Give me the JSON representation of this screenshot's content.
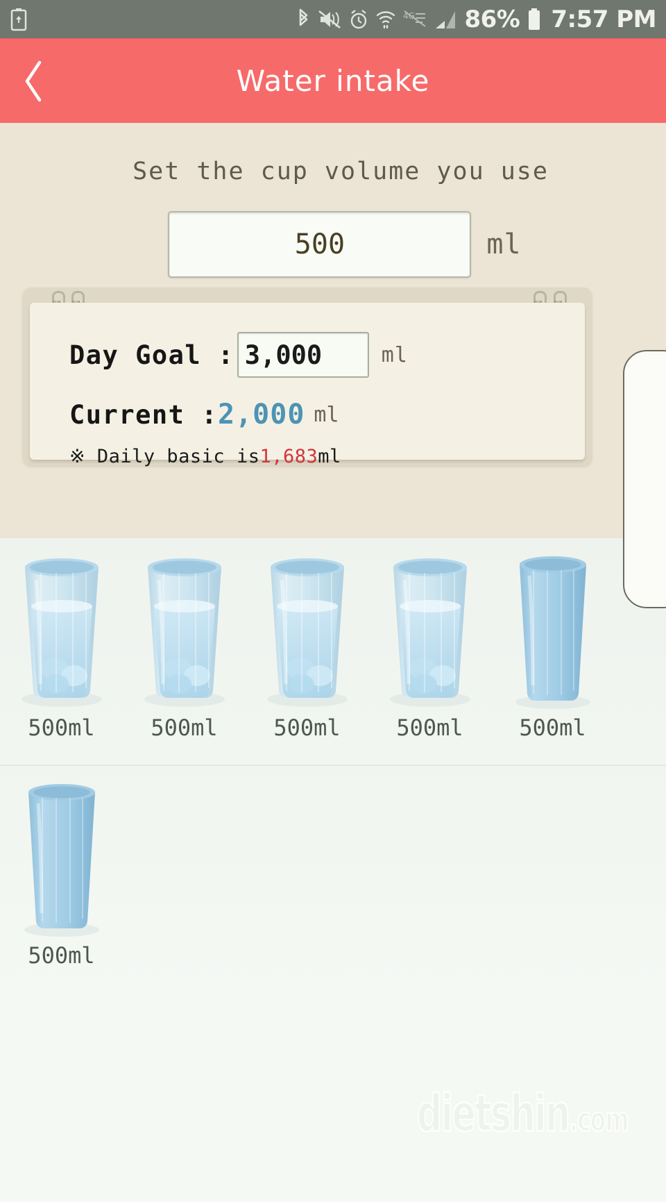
{
  "status_bar": {
    "left_icon": "battery-saver-icon",
    "icons": [
      "bluetooth-icon",
      "mute-vibrate-icon",
      "alarm-icon",
      "wifi-icon",
      "lte-data-icon",
      "signal-bars-icon"
    ],
    "battery_percent": "86%",
    "battery_icon": "battery-icon",
    "time": "7:57 PM"
  },
  "app_bar": {
    "back_icon": "chevron-left-icon",
    "title": "Water intake"
  },
  "cup_setting": {
    "label": "Set the cup volume you use",
    "value": "500",
    "placeholder": "500",
    "unit": "ml"
  },
  "goal_card": {
    "day_goal_label": "Day Goal :",
    "day_goal_value": "3,000",
    "day_goal_unit": "ml",
    "current_label": "Current :",
    "current_value": "2,000",
    "current_unit": "ml",
    "footnote_mark": "※",
    "footnote_prefix": " Daily basic is",
    "footnote_value": "1,683",
    "footnote_suffix": "ml"
  },
  "glasses": {
    "rows": [
      [
        {
          "label": "500ml",
          "state": "full"
        },
        {
          "label": "500ml",
          "state": "full"
        },
        {
          "label": "500ml",
          "state": "full"
        },
        {
          "label": "500ml",
          "state": "full"
        },
        {
          "label": "500ml",
          "state": "empty"
        }
      ],
      [
        {
          "label": "500ml",
          "state": "empty"
        }
      ]
    ]
  },
  "watermark": {
    "name": "dietshin",
    "tld": ".com"
  },
  "colors": {
    "status_bar": "#70776e",
    "app_bar": "#f76a6a",
    "beige_panel": "#ece4d4",
    "note_page": "#f4f1e4",
    "glass_area": "#eff4ee",
    "current_value": "#4d93b5",
    "footnote_value": "#d2343c"
  }
}
